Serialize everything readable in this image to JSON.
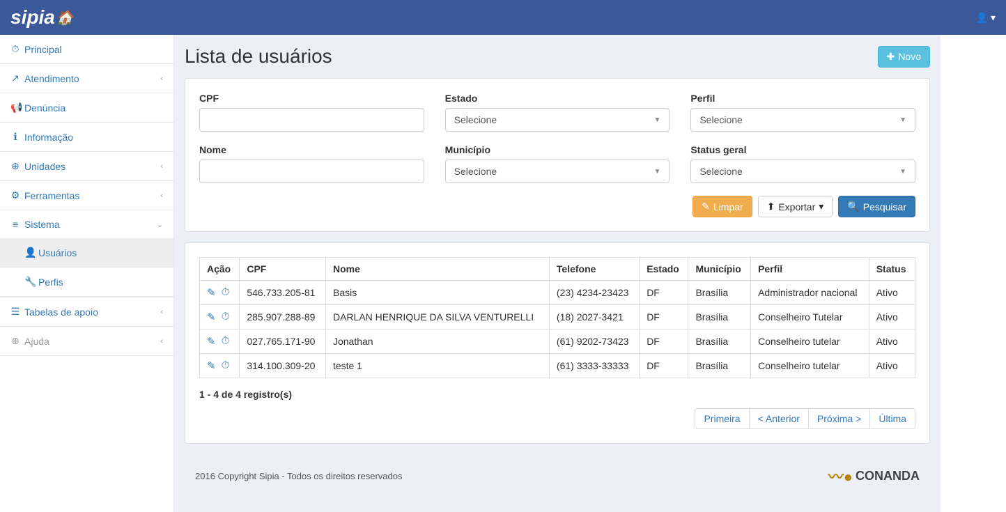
{
  "brand": "sipia",
  "page_title": "Lista de usuários",
  "new_button": "Novo",
  "sidebar": {
    "items": [
      {
        "label": "Principal",
        "icon": "⏱",
        "expandable": false
      },
      {
        "label": "Atendimento",
        "icon": "↗",
        "expandable": true
      },
      {
        "label": "Denúncia",
        "icon": "📢",
        "expandable": false
      },
      {
        "label": "Informação",
        "icon": "ℹ",
        "expandable": false
      },
      {
        "label": "Unidades",
        "icon": "⊕",
        "expandable": true
      },
      {
        "label": "Ferramentas",
        "icon": "⚙",
        "expandable": true
      },
      {
        "label": "Sistema",
        "icon": "≡",
        "expandable": true,
        "expanded": true
      },
      {
        "label": "Tabelas de apoio",
        "icon": "☰",
        "expandable": true
      },
      {
        "label": "Ajuda",
        "icon": "⊕",
        "expandable": true,
        "muted": true
      }
    ],
    "sistema_submenu": [
      {
        "label": "Usuários",
        "icon": "👤",
        "active": true
      },
      {
        "label": "Perfis",
        "icon": "🔧",
        "active": false
      }
    ]
  },
  "filters": {
    "cpf": {
      "label": "CPF",
      "value": ""
    },
    "nome": {
      "label": "Nome",
      "value": ""
    },
    "estado": {
      "label": "Estado",
      "placeholder": "Selecione"
    },
    "municipio": {
      "label": "Município",
      "placeholder": "Selecione"
    },
    "perfil": {
      "label": "Perfil",
      "placeholder": "Selecione"
    },
    "status_geral": {
      "label": "Status geral",
      "placeholder": "Selecione"
    }
  },
  "filter_buttons": {
    "limpar": "Limpar",
    "exportar": "Exportar",
    "pesquisar": "Pesquisar"
  },
  "table": {
    "headers": {
      "acao": "Ação",
      "cpf": "CPF",
      "nome": "Nome",
      "telefone": "Telefone",
      "estado": "Estado",
      "municipio": "Município",
      "perfil": "Perfil",
      "status": "Status"
    },
    "rows": [
      {
        "cpf": "546.733.205-81",
        "nome": "Basis",
        "telefone": "(23) 4234-23423",
        "estado": "DF",
        "municipio": "Brasília",
        "perfil": "Administrador nacional",
        "status": "Ativo"
      },
      {
        "cpf": "285.907.288-89",
        "nome": "DARLAN HENRIQUE DA SILVA VENTURELLI",
        "telefone": "(18) 2027-3421",
        "estado": "DF",
        "municipio": "Brasília",
        "perfil": "Conselheiro Tutelar",
        "status": "Ativo"
      },
      {
        "cpf": "027.765.171-90",
        "nome": "Jonathan",
        "telefone": "(61) 9202-73423",
        "estado": "DF",
        "municipio": "Brasília",
        "perfil": "Conselheiro tutelar",
        "status": "Ativo"
      },
      {
        "cpf": "314.100.309-20",
        "nome": "teste 1",
        "telefone": "(61) 3333-33333",
        "estado": "DF",
        "municipio": "Brasília",
        "perfil": "Conselheiro tutelar",
        "status": "Ativo"
      }
    ]
  },
  "records_info": "1 - 4 de 4 registro(s)",
  "pagination": {
    "first": "Primeira",
    "prev": "< Anterior",
    "next": "Próxima >",
    "last": "Última"
  },
  "footer": {
    "copyright": "2016 Copyright Sipia - Todos os direitos reservados",
    "logo": "CONANDA"
  }
}
